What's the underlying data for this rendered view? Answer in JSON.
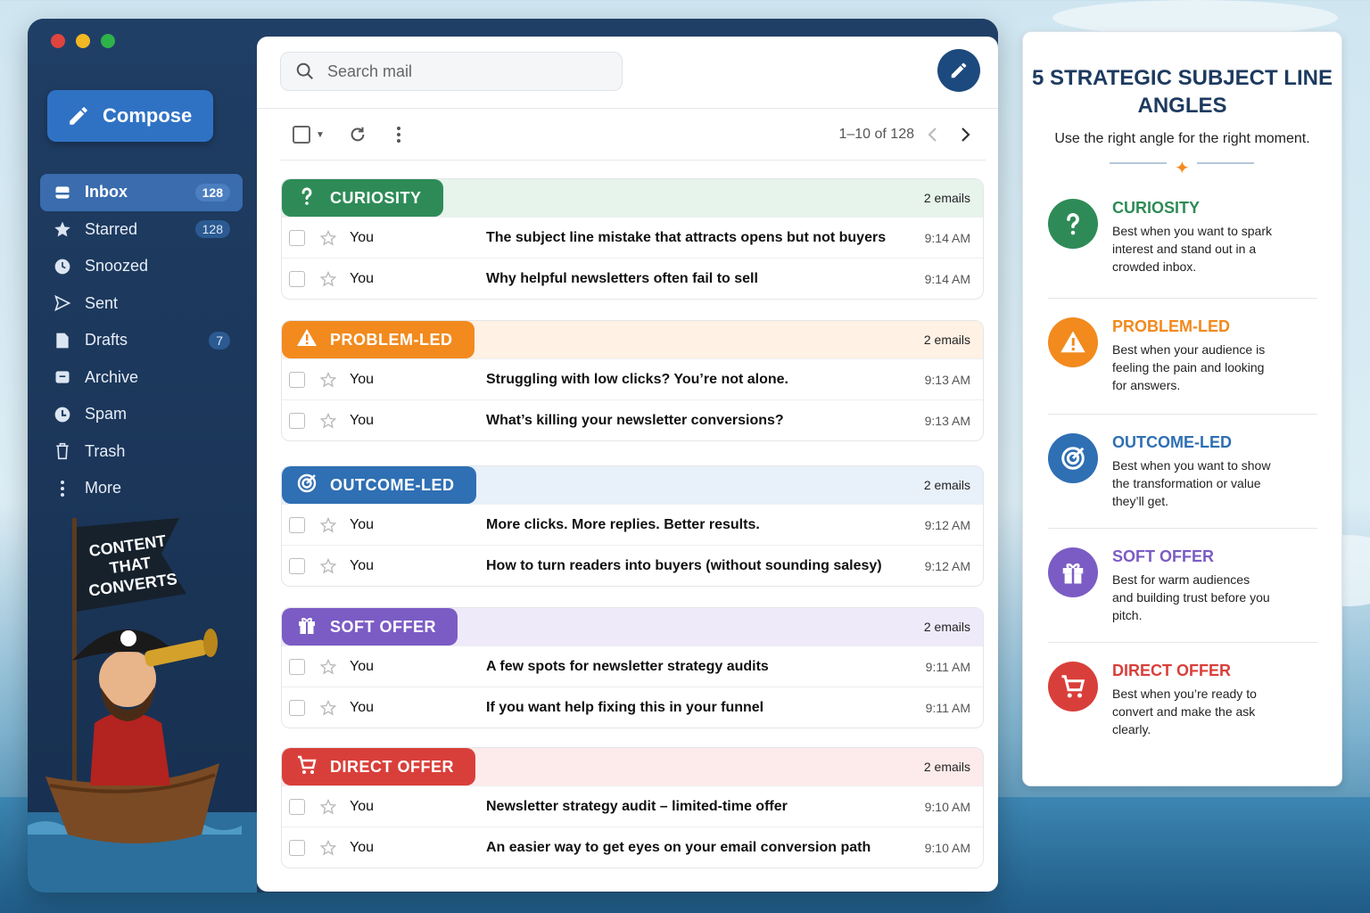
{
  "sidebar": {
    "compose_label": "Compose",
    "items": [
      {
        "label": "Inbox",
        "icon": "inbox-icon",
        "badge": "128"
      },
      {
        "label": "Starred",
        "icon": "star-icon",
        "badge": "128"
      },
      {
        "label": "Snoozed",
        "icon": "clock-icon",
        "badge": ""
      },
      {
        "label": "Sent",
        "icon": "send-icon",
        "badge": ""
      },
      {
        "label": "Drafts",
        "icon": "draft-icon",
        "badge": "7"
      },
      {
        "label": "Archive",
        "icon": "archive-icon",
        "badge": ""
      },
      {
        "label": "Spam",
        "icon": "spam-icon",
        "badge": ""
      },
      {
        "label": "Trash",
        "icon": "trash-icon",
        "badge": ""
      },
      {
        "label": "More",
        "icon": "more-icon",
        "badge": ""
      }
    ],
    "flag_text": [
      "CONTENT",
      "THAT",
      "CONVERTS"
    ]
  },
  "main": {
    "search_placeholder": "Search mail",
    "pager": "1–10 of 128",
    "groups": [
      {
        "label": "CURIOSITY",
        "count": "2 emails",
        "color": "#2e8b57",
        "tint": "#e6f4ec",
        "rows": [
          {
            "from": "You",
            "subject": "The subject line mistake that attracts opens but not buyers",
            "time": "9:14 AM"
          },
          {
            "from": "You",
            "subject": "Why helpful newsletters often fail to sell",
            "time": "9:14 AM"
          }
        ]
      },
      {
        "label": "PROBLEM-LED",
        "count": "2 emails",
        "color": "#f28a1e",
        "tint": "#fff1e4",
        "rows": [
          {
            "from": "You",
            "subject": "Struggling with low clicks? You’re not alone.",
            "time": "9:13 AM"
          },
          {
            "from": "You",
            "subject": "What’s killing your newsletter conversions?",
            "time": "9:13 AM"
          }
        ]
      },
      {
        "label": "OUTCOME-LED",
        "count": "2 emails",
        "color": "#2f6fb3",
        "tint": "#e8f0fa",
        "rows": [
          {
            "from": "You",
            "subject": "More clicks. More replies. Better results.",
            "time": "9:12 AM"
          },
          {
            "from": "You",
            "subject": "How to turn readers into buyers (without sounding salesy)",
            "time": "9:12 AM"
          }
        ]
      },
      {
        "label": "SOFT OFFER",
        "count": "2 emails",
        "color": "#7b5cc4",
        "tint": "#efeafa",
        "rows": [
          {
            "from": "You",
            "subject": "A few spots for newsletter strategy audits",
            "time": "9:11 AM"
          },
          {
            "from": "You",
            "subject": "If you want help fixing this in your funnel",
            "time": "9:11 AM"
          }
        ]
      },
      {
        "label": "DIRECT OFFER",
        "count": "2 emails",
        "color": "#d93f3a",
        "tint": "#fcebea",
        "rows": [
          {
            "from": "You",
            "subject": "Newsletter strategy audit – limited-time offer",
            "time": "9:10 AM"
          },
          {
            "from": "You",
            "subject": "An easier way to get eyes on your email conversion path",
            "time": "9:10 AM"
          }
        ]
      }
    ]
  },
  "panel": {
    "title_line1": "5 STRATEGIC SUBJECT LINE",
    "title_line2": "ANGLES",
    "subtitle": "Use the right angle for the right moment.",
    "angles": [
      {
        "title": "CURIOSITY",
        "desc": "Best when you want to spark interest and stand out in a crowded inbox.",
        "color": "#2e8b57",
        "icon": "question-icon"
      },
      {
        "title": "PROBLEM-LED",
        "desc": "Best when your audience is feeling the pain and looking for answers.",
        "color": "#f28a1e",
        "icon": "warning-icon"
      },
      {
        "title": "OUTCOME-LED",
        "desc": "Best when you want to show the transformation or value they’ll get.",
        "color": "#2f6fb3",
        "icon": "target-icon"
      },
      {
        "title": "SOFT OFFER",
        "desc": "Best for warm audiences and building trust before you pitch.",
        "color": "#7b5cc4",
        "icon": "gift-icon"
      },
      {
        "title": "DIRECT OFFER",
        "desc": "Best when you’re ready to convert and make the ask clearly.",
        "color": "#d93f3a",
        "icon": "cart-icon"
      }
    ]
  }
}
